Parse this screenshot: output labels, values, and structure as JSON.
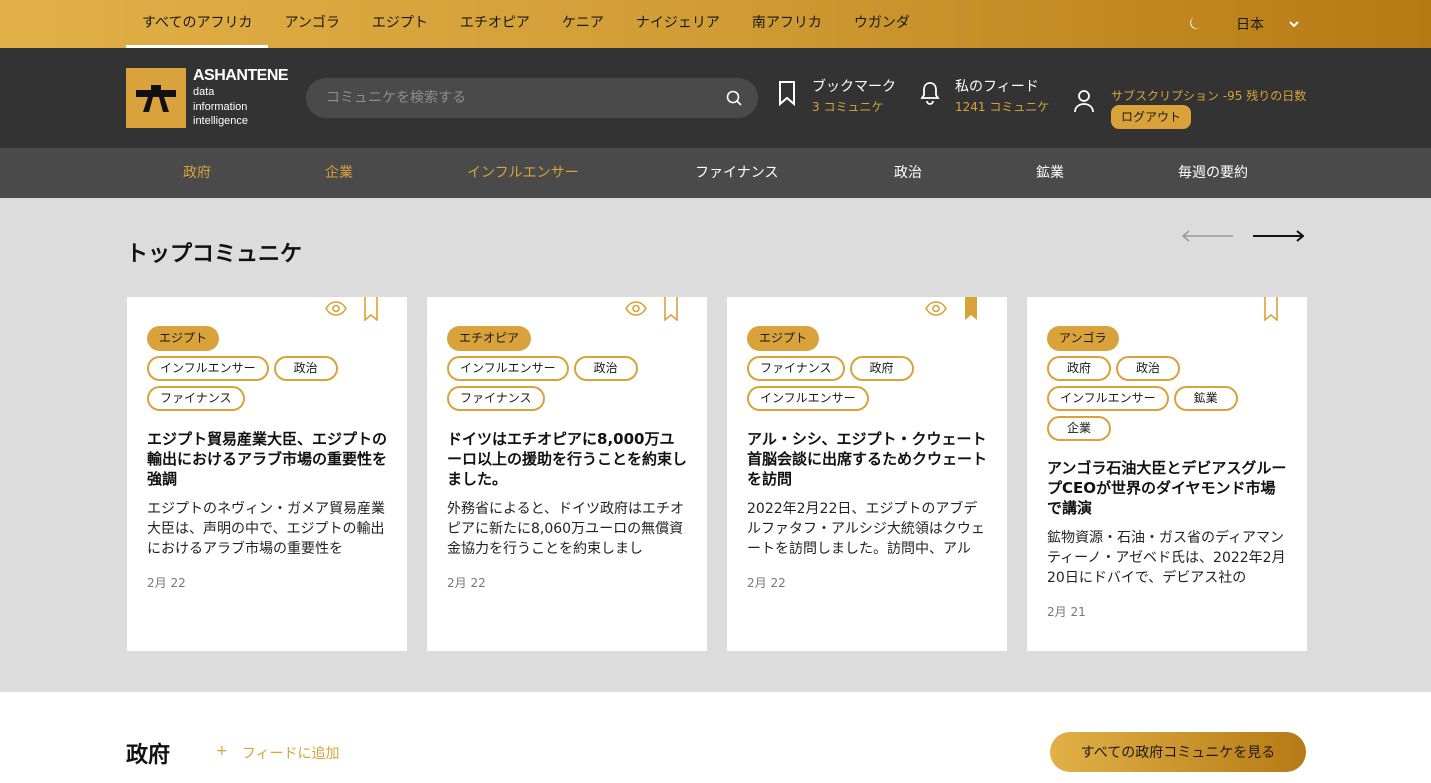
{
  "countries": [
    "すべてのアフリカ",
    "アンゴラ",
    "エジプト",
    "エチオピア",
    "ケニア",
    "ナイジェリア",
    "南アフリカ",
    "ウガンダ"
  ],
  "language": "日本",
  "logo": {
    "name": "ASHANTENE",
    "line1": "data",
    "line2": "information",
    "line3": "intelligence"
  },
  "search": {
    "placeholder": "コミュニケを検索する"
  },
  "bookmarks": {
    "title": "ブックマーク",
    "sub": "3 コミュニケ"
  },
  "feed": {
    "title": "私のフィード",
    "sub": "1241  コミュニケ"
  },
  "subscription": {
    "text": "サブスクリプション -95 残りの日数",
    "logout": "ログアウト"
  },
  "categories": [
    "政府",
    "企業",
    "インフルエンサー",
    "ファイナンス",
    "政治",
    "鉱業",
    "毎週の要約"
  ],
  "top_section": {
    "title": "トップコミュニケ"
  },
  "cards": [
    {
      "country": "エジプト",
      "tags": [
        "インフルエンサー",
        "政治",
        "ファイナンス"
      ],
      "title": "エジプト貿易産業大臣、エジプトの輸出におけるアラブ市場の重要性を強調",
      "body": "エジプトのネヴィン・ガメア貿易産業大臣は、声明の中で、エジプトの輸出におけるアラブ市場の重要性を",
      "date": "2月 22",
      "bookmarked": false
    },
    {
      "country": "エチオピア",
      "tags": [
        "インフルエンサー",
        "政治",
        "ファイナンス"
      ],
      "title": "ドイツはエチオピアに8,000万ユーロ以上の援助を行うことを約束しました。",
      "body": "外務省によると、ドイツ政府はエチオピアに新たに8,060万ユーロの無償資金協力を行うことを約束しまし",
      "date": "2月 22",
      "bookmarked": false
    },
    {
      "country": "エジプト",
      "tags": [
        "ファイナンス",
        "政府",
        "インフルエンサー"
      ],
      "title": "アル・シシ、エジプト・クウェート首脳会談に出席するためクウェートを訪問",
      "body": "2022年2月22日、エジプトのアブデルファタフ・アルシジ大統領はクウェートを訪問しました。訪問中、アル",
      "date": "2月 22",
      "bookmarked": true
    },
    {
      "country": "アンゴラ",
      "tags": [
        "政府",
        "政治",
        "インフルエンサー",
        "鉱業",
        "企業"
      ],
      "title": "アンゴラ石油大臣とデビアスグループCEOが世界のダイヤモンド市場で講演",
      "body": "鉱物資源・石油・ガス省のディアマンティーノ・アゼベド氏は、2022年2月20日にドバイで、デビアス社の",
      "date": "2月 21",
      "bookmarked": false
    }
  ],
  "gov_section": {
    "title": "政府",
    "add_feed_icon": "+",
    "add_feed": "フィードに追加",
    "see_all": "すべての政府コミュニケを見る"
  },
  "colors": {
    "gold": "#d9a23a",
    "header": "#333333",
    "nav": "#4a4a4a",
    "section_bg": "#dcdcdc"
  }
}
